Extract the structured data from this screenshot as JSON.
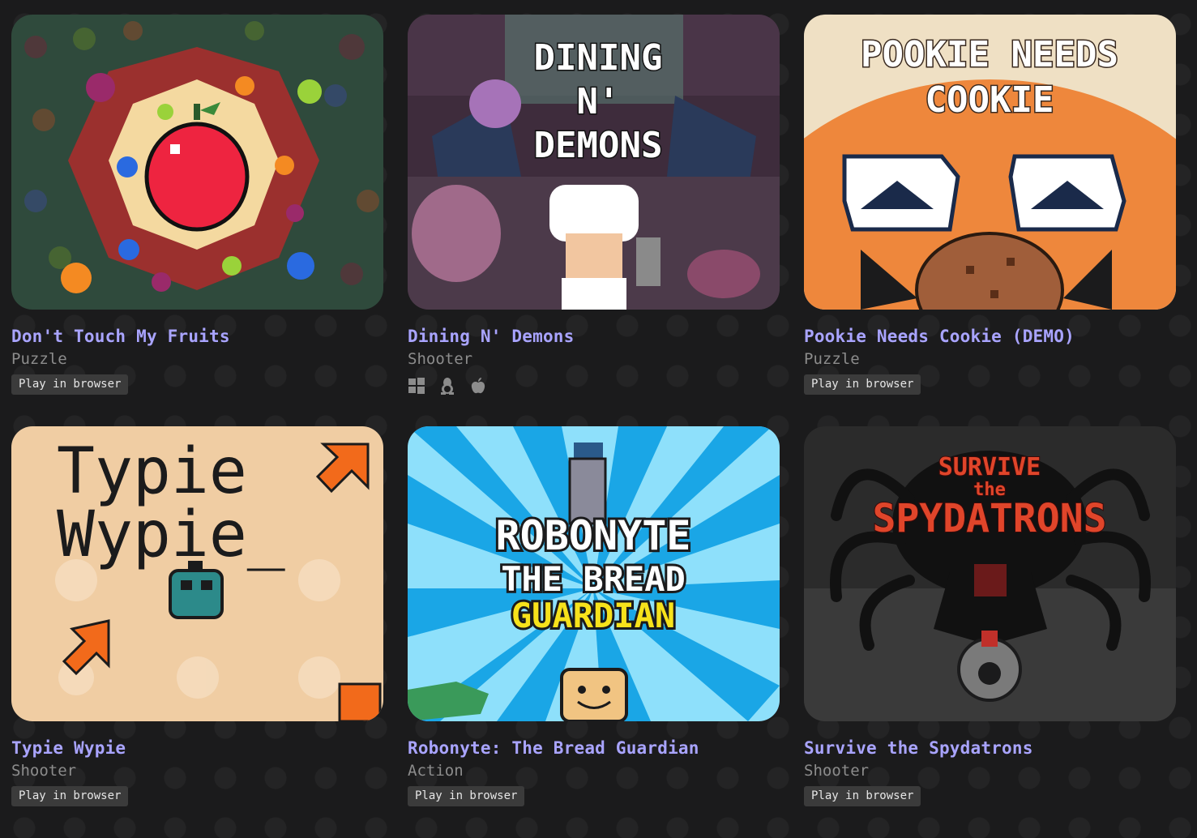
{
  "games": [
    {
      "title": "Don't Touch My Fruits",
      "genre": "Puzzle",
      "badge": "Play in browser",
      "thumb_icon": "fruit-thumbnail",
      "colors": {
        "bg": "#2d4a3a",
        "accent": "#e82a3c"
      }
    },
    {
      "title": "Dining N' Demons",
      "genre": "Shooter",
      "platforms": [
        "windows-icon",
        "linux-icon",
        "apple-icon"
      ],
      "thumb_title": [
        "DINING",
        "N'",
        "DEMONS"
      ],
      "colors": {
        "bg": "#5a3a55",
        "accent": "#ffffff"
      }
    },
    {
      "title": "Pookie Needs Cookie (DEMO)",
      "genre": "Puzzle",
      "badge": "Play in browser",
      "thumb_title": [
        "POOKIE NEEDS",
        "COOKIE"
      ],
      "colors": {
        "bg": "#ef8a3c",
        "accent": "#f3e3c8"
      }
    },
    {
      "title": "Typie Wypie",
      "genre": "Shooter",
      "badge": "Play in browser",
      "thumb_title": [
        "Typie",
        "Wypie_"
      ],
      "colors": {
        "bg": "#f0cfa3",
        "accent": "#f26a1b"
      }
    },
    {
      "title": "Robonyte: The Bread Guardian",
      "genre": "Action",
      "badge": "Play in browser",
      "thumb_title": [
        "ROBONYTE",
        "THE BREAD",
        "GUARDIAN"
      ],
      "colors": {
        "bg": "#3fb7ea",
        "accent": "#f7e21b"
      }
    },
    {
      "title": "Survive the Spydatrons",
      "genre": "Shooter",
      "badge": "Play in browser",
      "thumb_title": [
        "SURVIVE",
        "the",
        "SPYDATRONS"
      ],
      "colors": {
        "bg": "#2a2a2a",
        "accent": "#e0452a"
      }
    }
  ]
}
